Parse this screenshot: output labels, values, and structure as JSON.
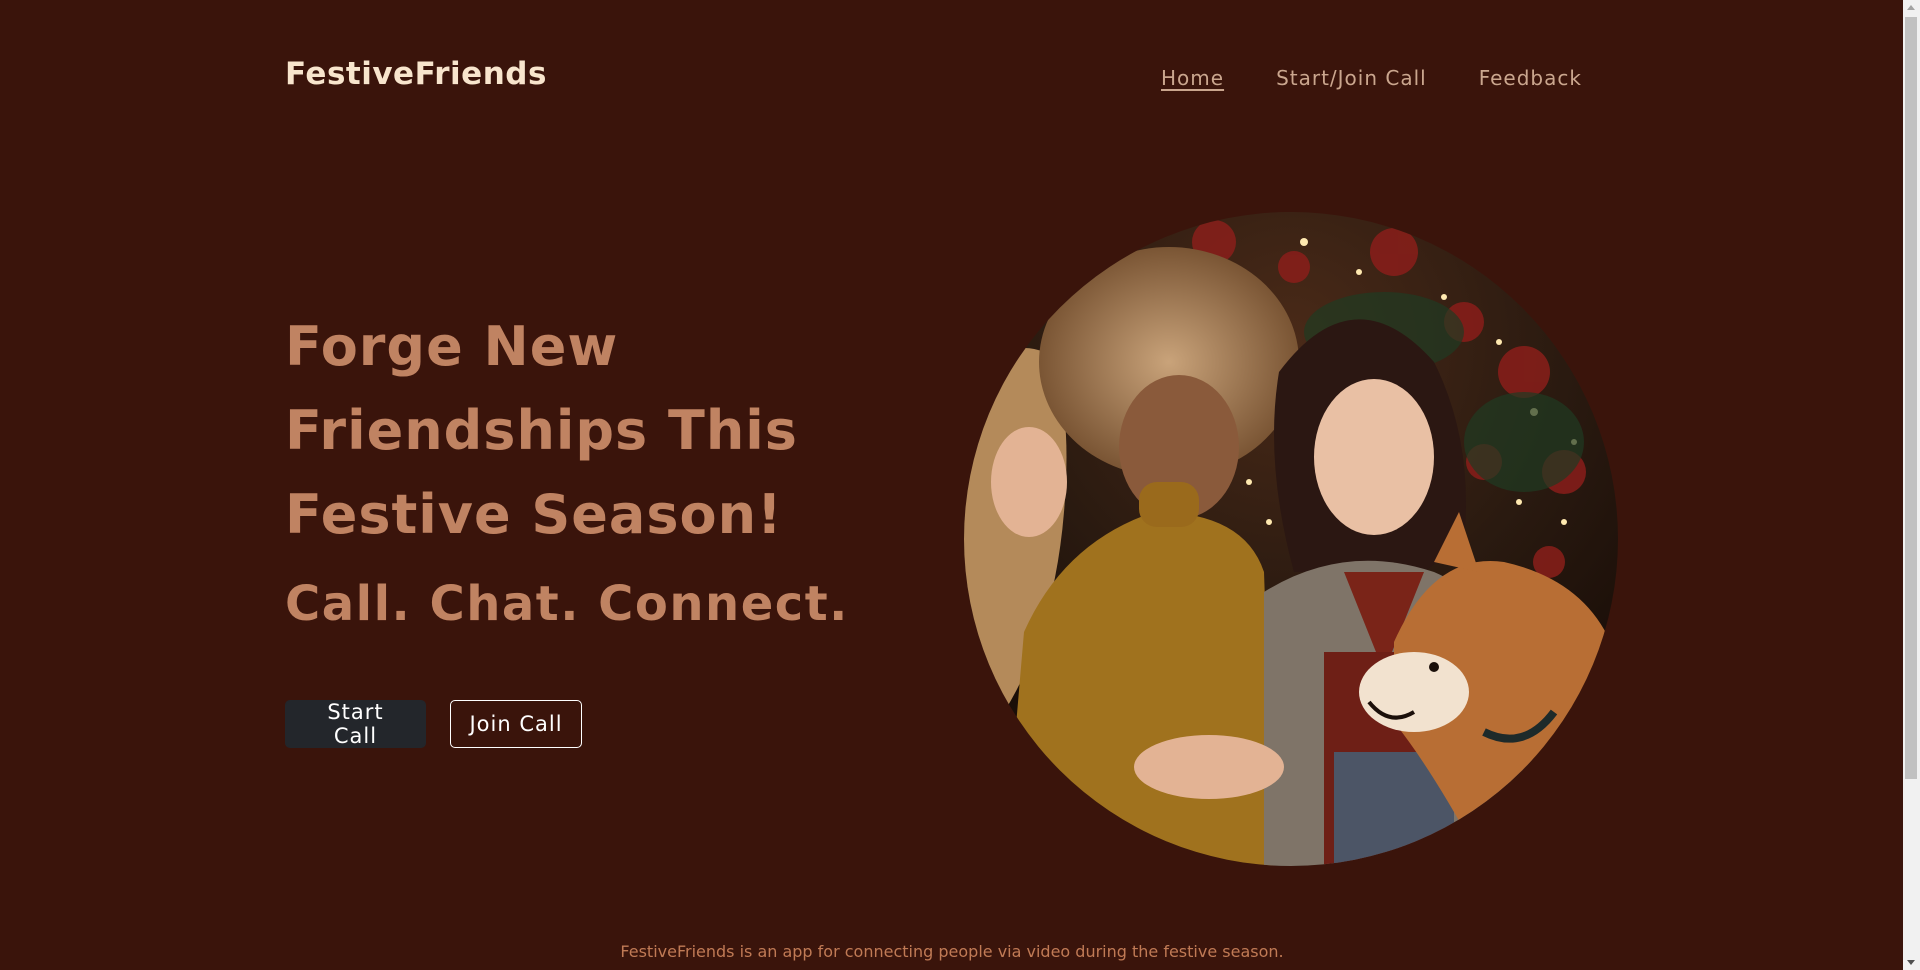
{
  "brand": {
    "name": "FestiveFriends"
  },
  "nav": {
    "items": [
      {
        "label": "Home",
        "active": true
      },
      {
        "label": "Start/Join Call",
        "active": false
      },
      {
        "label": "Feedback",
        "active": false
      }
    ]
  },
  "hero": {
    "title_lines": [
      "Forge New",
      "Friendships This",
      "Festive Season!"
    ],
    "subtitle": "Call. Chat. Connect.",
    "buttons": {
      "start_call": "Start Call",
      "join_call": "Join Call"
    },
    "image": {
      "icon": "hero-photo-three-friends-with-dog-christmas-tree"
    }
  },
  "footer": {
    "text": "FestiveFriends is an app for connecting people via video during the festive season."
  },
  "colors": {
    "background": "#3a140b",
    "brand": "#f8e5cd",
    "accent": "#c08362",
    "nav_text": "#caa68e",
    "start_button_bg": "#23262b",
    "footer_text": "#c07a55"
  }
}
